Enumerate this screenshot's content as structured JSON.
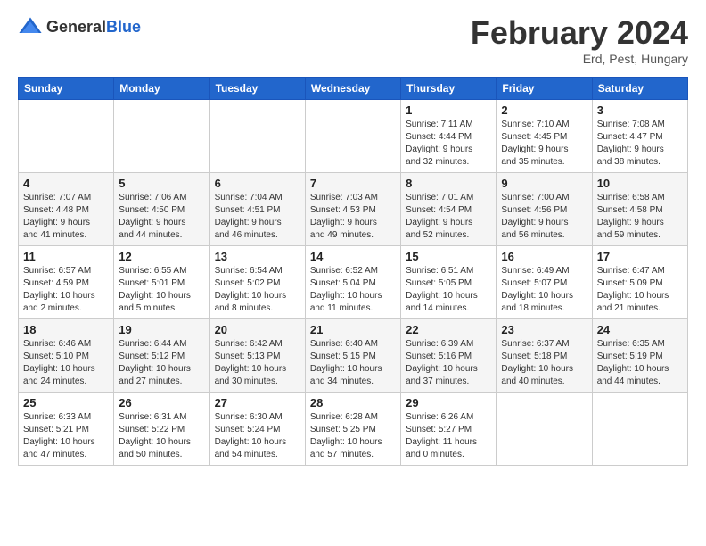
{
  "header": {
    "logo_general": "General",
    "logo_blue": "Blue",
    "title": "February 2024",
    "subtitle": "Erd, Pest, Hungary"
  },
  "days_of_week": [
    "Sunday",
    "Monday",
    "Tuesday",
    "Wednesday",
    "Thursday",
    "Friday",
    "Saturday"
  ],
  "weeks": [
    [
      {
        "day": "",
        "info": ""
      },
      {
        "day": "",
        "info": ""
      },
      {
        "day": "",
        "info": ""
      },
      {
        "day": "",
        "info": ""
      },
      {
        "day": "1",
        "info": "Sunrise: 7:11 AM\nSunset: 4:44 PM\nDaylight: 9 hours\nand 32 minutes."
      },
      {
        "day": "2",
        "info": "Sunrise: 7:10 AM\nSunset: 4:45 PM\nDaylight: 9 hours\nand 35 minutes."
      },
      {
        "day": "3",
        "info": "Sunrise: 7:08 AM\nSunset: 4:47 PM\nDaylight: 9 hours\nand 38 minutes."
      }
    ],
    [
      {
        "day": "4",
        "info": "Sunrise: 7:07 AM\nSunset: 4:48 PM\nDaylight: 9 hours\nand 41 minutes."
      },
      {
        "day": "5",
        "info": "Sunrise: 7:06 AM\nSunset: 4:50 PM\nDaylight: 9 hours\nand 44 minutes."
      },
      {
        "day": "6",
        "info": "Sunrise: 7:04 AM\nSunset: 4:51 PM\nDaylight: 9 hours\nand 46 minutes."
      },
      {
        "day": "7",
        "info": "Sunrise: 7:03 AM\nSunset: 4:53 PM\nDaylight: 9 hours\nand 49 minutes."
      },
      {
        "day": "8",
        "info": "Sunrise: 7:01 AM\nSunset: 4:54 PM\nDaylight: 9 hours\nand 52 minutes."
      },
      {
        "day": "9",
        "info": "Sunrise: 7:00 AM\nSunset: 4:56 PM\nDaylight: 9 hours\nand 56 minutes."
      },
      {
        "day": "10",
        "info": "Sunrise: 6:58 AM\nSunset: 4:58 PM\nDaylight: 9 hours\nand 59 minutes."
      }
    ],
    [
      {
        "day": "11",
        "info": "Sunrise: 6:57 AM\nSunset: 4:59 PM\nDaylight: 10 hours\nand 2 minutes."
      },
      {
        "day": "12",
        "info": "Sunrise: 6:55 AM\nSunset: 5:01 PM\nDaylight: 10 hours\nand 5 minutes."
      },
      {
        "day": "13",
        "info": "Sunrise: 6:54 AM\nSunset: 5:02 PM\nDaylight: 10 hours\nand 8 minutes."
      },
      {
        "day": "14",
        "info": "Sunrise: 6:52 AM\nSunset: 5:04 PM\nDaylight: 10 hours\nand 11 minutes."
      },
      {
        "day": "15",
        "info": "Sunrise: 6:51 AM\nSunset: 5:05 PM\nDaylight: 10 hours\nand 14 minutes."
      },
      {
        "day": "16",
        "info": "Sunrise: 6:49 AM\nSunset: 5:07 PM\nDaylight: 10 hours\nand 18 minutes."
      },
      {
        "day": "17",
        "info": "Sunrise: 6:47 AM\nSunset: 5:09 PM\nDaylight: 10 hours\nand 21 minutes."
      }
    ],
    [
      {
        "day": "18",
        "info": "Sunrise: 6:46 AM\nSunset: 5:10 PM\nDaylight: 10 hours\nand 24 minutes."
      },
      {
        "day": "19",
        "info": "Sunrise: 6:44 AM\nSunset: 5:12 PM\nDaylight: 10 hours\nand 27 minutes."
      },
      {
        "day": "20",
        "info": "Sunrise: 6:42 AM\nSunset: 5:13 PM\nDaylight: 10 hours\nand 30 minutes."
      },
      {
        "day": "21",
        "info": "Sunrise: 6:40 AM\nSunset: 5:15 PM\nDaylight: 10 hours\nand 34 minutes."
      },
      {
        "day": "22",
        "info": "Sunrise: 6:39 AM\nSunset: 5:16 PM\nDaylight: 10 hours\nand 37 minutes."
      },
      {
        "day": "23",
        "info": "Sunrise: 6:37 AM\nSunset: 5:18 PM\nDaylight: 10 hours\nand 40 minutes."
      },
      {
        "day": "24",
        "info": "Sunrise: 6:35 AM\nSunset: 5:19 PM\nDaylight: 10 hours\nand 44 minutes."
      }
    ],
    [
      {
        "day": "25",
        "info": "Sunrise: 6:33 AM\nSunset: 5:21 PM\nDaylight: 10 hours\nand 47 minutes."
      },
      {
        "day": "26",
        "info": "Sunrise: 6:31 AM\nSunset: 5:22 PM\nDaylight: 10 hours\nand 50 minutes."
      },
      {
        "day": "27",
        "info": "Sunrise: 6:30 AM\nSunset: 5:24 PM\nDaylight: 10 hours\nand 54 minutes."
      },
      {
        "day": "28",
        "info": "Sunrise: 6:28 AM\nSunset: 5:25 PM\nDaylight: 10 hours\nand 57 minutes."
      },
      {
        "day": "29",
        "info": "Sunrise: 6:26 AM\nSunset: 5:27 PM\nDaylight: 11 hours\nand 0 minutes."
      },
      {
        "day": "",
        "info": ""
      },
      {
        "day": "",
        "info": ""
      }
    ]
  ]
}
